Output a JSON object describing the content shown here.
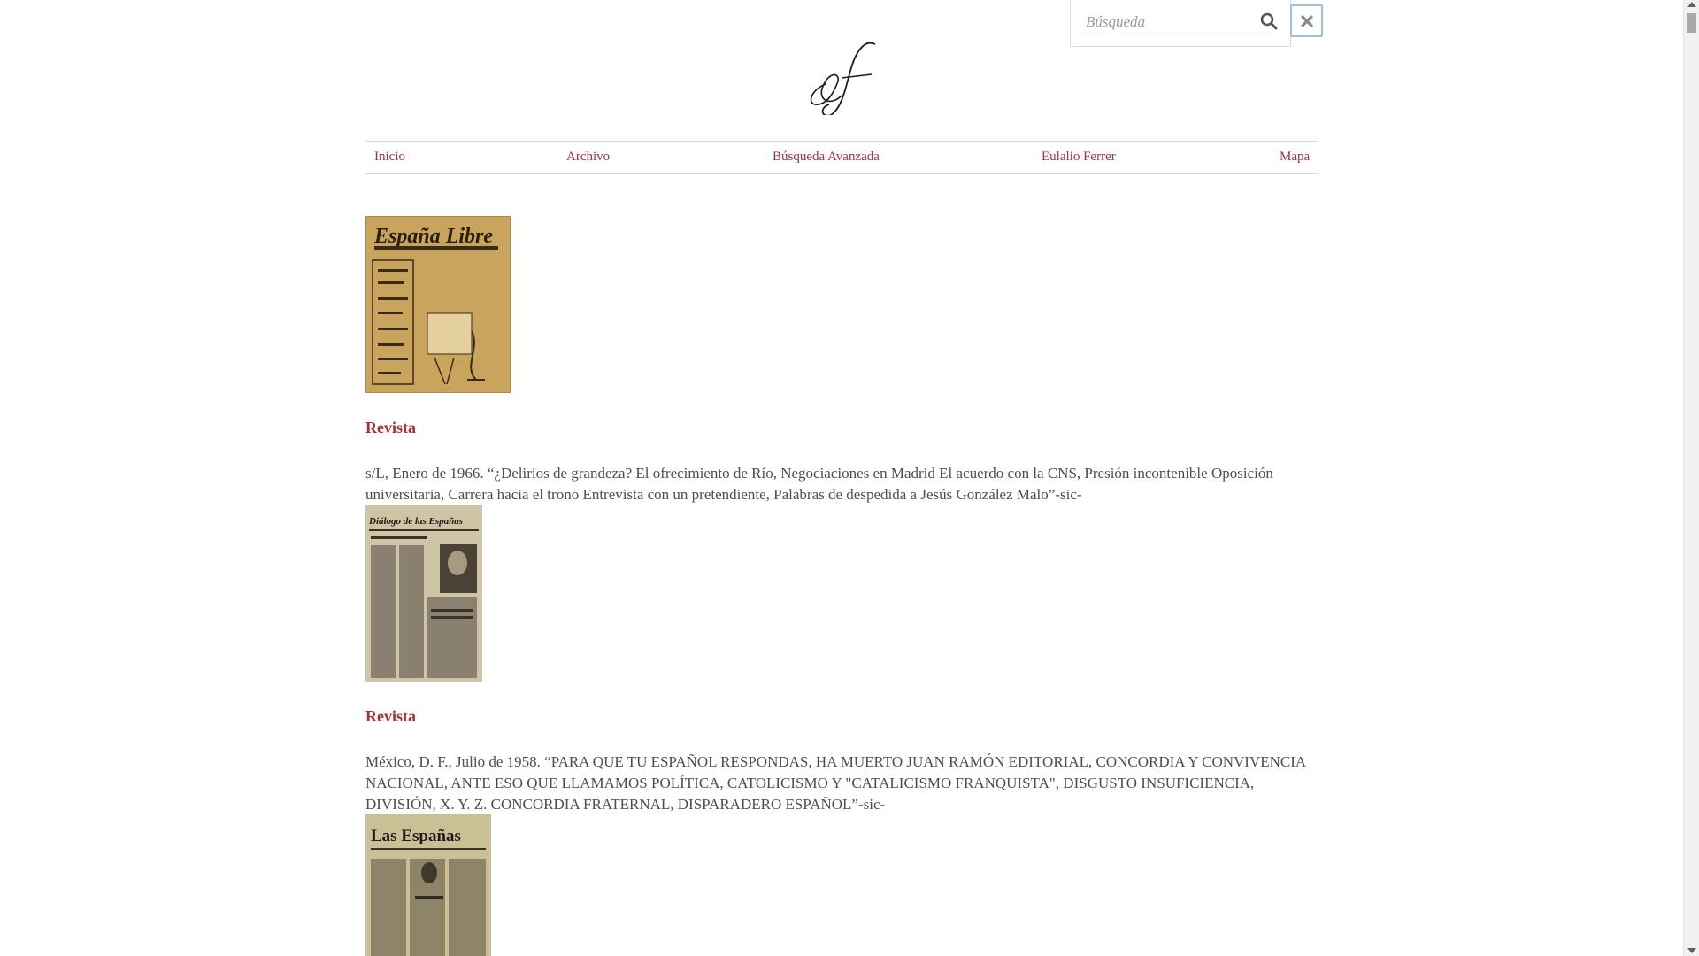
{
  "search": {
    "placeholder": "Búsqueda"
  },
  "logo": {
    "text": "ef"
  },
  "nav": {
    "items": [
      {
        "label": "Inicio"
      },
      {
        "label": "Archivo"
      },
      {
        "label": "Búsqueda Avanzada"
      },
      {
        "label": "Eulalio Ferrer"
      },
      {
        "label": "Mapa"
      }
    ]
  },
  "entries": [
    {
      "cover_title": "España Libre",
      "type": "Revista",
      "description": "s/L, Enero de 1966. “¿Delirios de grandeza? El ofrecimiento de Río, Negociaciones en Madrid El acuerdo con la CNS, Presión incontenible Oposición universitaria, Carrera hacia el trono Entrevista con un pretendiente, Palabras de despedida a Jesús González Malo”-sic-"
    },
    {
      "cover_title": "Diálogo de las Españas",
      "type": "Revista",
      "description": "México, D. F., Julio de 1958. “PARA QUE TU ESPAÑOL RESPONDAS, HA MUERTO JUAN RAMÓN EDITORIAL, CONCORDIA Y CONVIVENCIA NACIONAL, ANTE ESO QUE LLAMAMOS POLÍTICA, CATOLICISMO Y \"CATALICISMO FRANQUISTA\", DISGUSTO INSUFICIENCIA, DIVISIÓN, X. Y. Z. CONCORDIA FRATERNAL, DISPARADERO ESPAÑOL”-sic-"
    },
    {
      "cover_title": "Las Españas"
    }
  ]
}
